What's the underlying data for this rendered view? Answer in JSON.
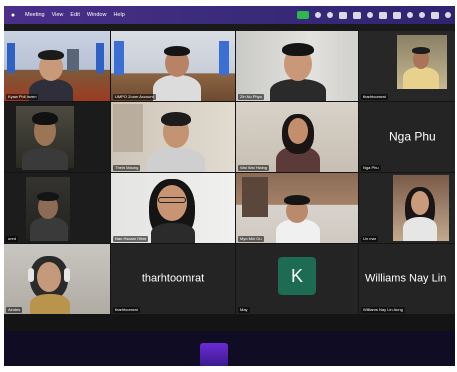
{
  "menubar": {
    "items": [
      "Meeting",
      "View",
      "Edit",
      "Window",
      "Help"
    ]
  },
  "tiles": [
    {
      "name": "Kyaw Phil Inzen",
      "big": ""
    },
    {
      "name": "UMPO Zoom Account",
      "big": ""
    },
    {
      "name": "Zin Nu Phyo",
      "big": ""
    },
    {
      "name": "tharhtoomrat",
      "big": ""
    },
    {
      "name": "",
      "big": ""
    },
    {
      "name": "Thein Maung",
      "big": ""
    },
    {
      "name": "Wai Wai Hlaing",
      "big": ""
    },
    {
      "name": "Nga Phu",
      "big": "Nga Phu"
    },
    {
      "name": "ured",
      "big": ""
    },
    {
      "name": "Nan Hsaam Hline",
      "big": ""
    },
    {
      "name": "Myo Min Ou",
      "big": ""
    },
    {
      "name": "Un mar",
      "big": ""
    },
    {
      "name": "Aindes",
      "big": ""
    },
    {
      "name": "tharhtoomrat",
      "big": "tharhtoomrat"
    },
    {
      "name": "May",
      "big": "K"
    },
    {
      "name": "Williams Nay Lin Aung",
      "big": "Williams Nay Lin"
    }
  ],
  "colors": {
    "active_border": "#39c151",
    "avatar_k": "#1d6b52",
    "menubar": "#3d2c7d"
  }
}
